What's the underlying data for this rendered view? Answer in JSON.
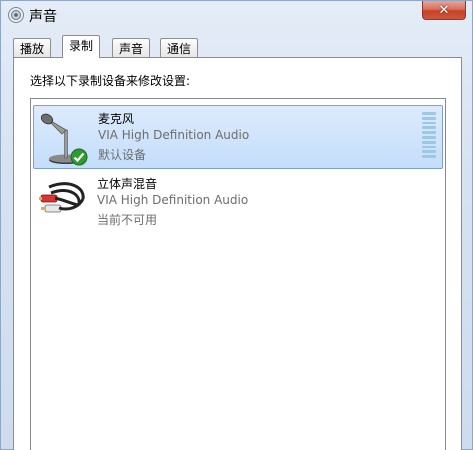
{
  "window": {
    "title": "声音",
    "close_glyph": "✕"
  },
  "tabs": [
    {
      "label": "播放",
      "active": false
    },
    {
      "label": "录制",
      "active": true
    },
    {
      "label": "声音",
      "active": false
    },
    {
      "label": "通信",
      "active": false
    }
  ],
  "recording": {
    "instruction": "选择以下录制设备来修改设置:",
    "devices": [
      {
        "name": "麦克风",
        "driver": "VIA High Definition Audio",
        "status": "默认设备",
        "icon": "microphone-icon",
        "selected": true,
        "default": true,
        "level": 0
      },
      {
        "name": "立体声混音",
        "driver": "VIA High Definition Audio",
        "status": "当前不可用",
        "icon": "rca-cable-icon",
        "selected": false,
        "default": false
      }
    ]
  },
  "colors": {
    "selection": "#c4ddfb",
    "selection_border": "#7da2ce",
    "close_button": "#c5432b",
    "check": "#2f9a2f"
  }
}
